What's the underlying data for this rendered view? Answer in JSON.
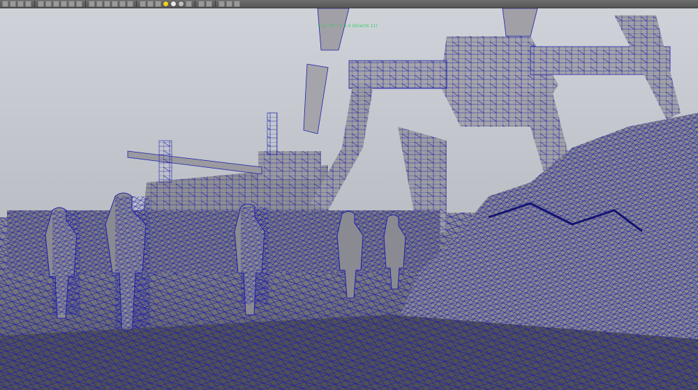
{
  "viewport": {
    "camera_name": "",
    "renderer_label": "ビューポート 2.0 (DirectX 11)"
  },
  "toolbar": {
    "buttons": [
      {
        "icon": "select-camera-icon",
        "style": "normal"
      },
      {
        "icon": "camera-attributes-icon",
        "style": "normal"
      },
      {
        "icon": "bookmarks-icon",
        "style": "normal"
      },
      {
        "icon": "image-plane-icon",
        "style": "normal"
      },
      {
        "icon": "sep"
      },
      {
        "icon": "grid-icon",
        "style": "normal"
      },
      {
        "icon": "film-gate-icon",
        "style": "normal"
      },
      {
        "icon": "resolution-gate-icon",
        "style": "normal"
      },
      {
        "icon": "gate-mask-icon",
        "style": "normal"
      },
      {
        "icon": "field-chart-icon",
        "style": "normal"
      },
      {
        "icon": "safe-action-icon",
        "style": "normal"
      },
      {
        "icon": "sep"
      },
      {
        "icon": "wireframe-icon",
        "style": "normal"
      },
      {
        "icon": "smooth-shade-icon",
        "style": "normal"
      },
      {
        "icon": "wireframe-on-shaded-icon",
        "style": "normal"
      },
      {
        "icon": "textured-icon",
        "style": "normal"
      },
      {
        "icon": "use-lights-icon",
        "style": "normal"
      },
      {
        "icon": "shadows-icon",
        "style": "normal"
      },
      {
        "icon": "sep"
      },
      {
        "icon": "xray-icon",
        "style": "normal"
      },
      {
        "icon": "xray-joints-icon",
        "style": "normal"
      },
      {
        "icon": "backface-culling-icon",
        "style": "normal"
      },
      {
        "icon": "screen-space-ao-icon",
        "style": "dot",
        "color": "#f0d020"
      },
      {
        "icon": "motion-blur-icon",
        "style": "dot",
        "color": "#e8e8e8"
      },
      {
        "icon": "anti-aliasing-icon",
        "style": "dot",
        "color": "#c0c0c0"
      },
      {
        "icon": "depth-of-field-icon",
        "style": "normal"
      },
      {
        "icon": "sep"
      },
      {
        "icon": "isolate-select-icon",
        "style": "normal"
      },
      {
        "icon": "xray-active-icon",
        "style": "normal"
      },
      {
        "icon": "sep"
      },
      {
        "icon": "exposure-icon",
        "style": "normal"
      },
      {
        "icon": "gamma-icon",
        "style": "normal"
      },
      {
        "icon": "color-management-icon",
        "style": "normal"
      }
    ]
  },
  "colors": {
    "wire": "#1e1eaa",
    "sky_top": "#d2d6dc",
    "sky_bottom": "#b8bcc2",
    "shade_light": "#a9a9ad",
    "shade_mid": "#8e8e92",
    "shade_dark": "#5f5f66",
    "hud_text": "#33cc66"
  }
}
